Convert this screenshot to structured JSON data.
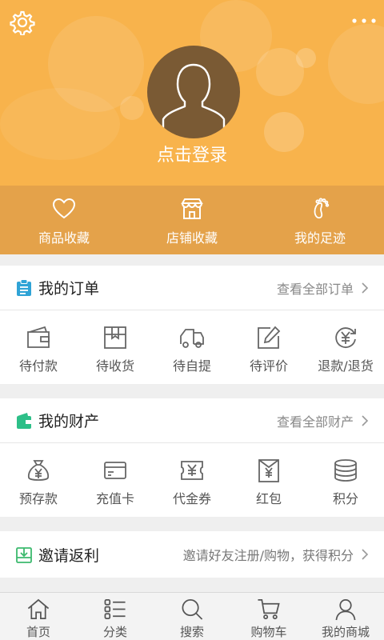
{
  "header": {
    "login_text": "点击登录",
    "background_color": "#f8b34c",
    "icons": [
      "gear-icon",
      "more-icon",
      "avatar-silhouette-icon"
    ]
  },
  "favorites": [
    {
      "label": "商品收藏",
      "icon": "heart-icon"
    },
    {
      "label": "店铺收藏",
      "icon": "store-icon"
    },
    {
      "label": "我的足迹",
      "icon": "footprint-icon"
    }
  ],
  "orders": {
    "title": "我的订单",
    "link": "查看全部订单",
    "icon": "clipboard-icon",
    "items": [
      {
        "label": "待付款",
        "icon": "wallet-icon"
      },
      {
        "label": "待收货",
        "icon": "box-icon"
      },
      {
        "label": "待自提",
        "icon": "truck-icon"
      },
      {
        "label": "待评价",
        "icon": "edit-icon"
      },
      {
        "label": "退款/退货",
        "icon": "refund-icon"
      }
    ]
  },
  "assets": {
    "title": "我的财产",
    "link": "查看全部财产",
    "icon": "wallet-green-icon",
    "items": [
      {
        "label": "预存款",
        "icon": "money-bag-icon"
      },
      {
        "label": "充值卡",
        "icon": "card-icon"
      },
      {
        "label": "代金券",
        "icon": "voucher-icon"
      },
      {
        "label": "红包",
        "icon": "red-envelope-icon"
      },
      {
        "label": "积分",
        "icon": "coins-icon"
      }
    ]
  },
  "invite": {
    "title": "邀请返利",
    "link": "邀请好友注册/购物，获得积分",
    "icon": "invite-icon"
  },
  "tabbar": [
    {
      "label": "首页",
      "icon": "home-icon"
    },
    {
      "label": "分类",
      "icon": "list-icon"
    },
    {
      "label": "搜索",
      "icon": "search-icon"
    },
    {
      "label": "购物车",
      "icon": "cart-icon"
    },
    {
      "label": "我的商城",
      "icon": "user-icon"
    }
  ],
  "colors": {
    "header": "#f8b34c",
    "fav_bar": "#e4a24a",
    "order_icon": "#2fa3d6",
    "asset_icon": "#2dbf88",
    "invite_icon": "#3cb96e"
  }
}
